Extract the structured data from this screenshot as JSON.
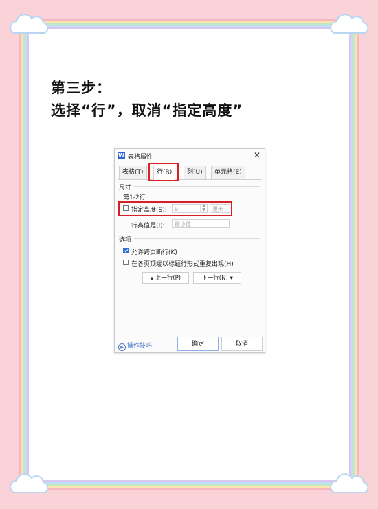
{
  "heading": {
    "line1": "第三步：",
    "line2": "选择“行”，取消“指定高度”"
  },
  "dialog": {
    "app_icon": "W",
    "title": "表格属性",
    "close_glyph": "✕",
    "tabs": [
      "表格(T)",
      "行(R)",
      "列(U)",
      "单元格(E)"
    ],
    "active_tab": "行(R)",
    "size_section": "尺寸",
    "row_range": "第1-2行",
    "specify_height": {
      "label": "指定高度(S):",
      "value": "9",
      "unit": "厘米",
      "checked": false
    },
    "row_height_is": {
      "label": "行高值是(I):",
      "value": "最小值"
    },
    "options_section": "选项",
    "allow_break": {
      "label": "允许跨页断行(K)",
      "checked": true
    },
    "repeat_header": {
      "label": "在各页顶端以标题行形式重复出现(H)",
      "checked": false
    },
    "prev_row": "▴ 上一行(P)",
    "next_row": "下一行(N) ▾",
    "tips": "操作技巧",
    "ok": "确定",
    "cancel": "取消"
  },
  "colors": {
    "background": "#f9d3d8",
    "highlight": "#d81f26",
    "accent": "#2f6fd6"
  }
}
